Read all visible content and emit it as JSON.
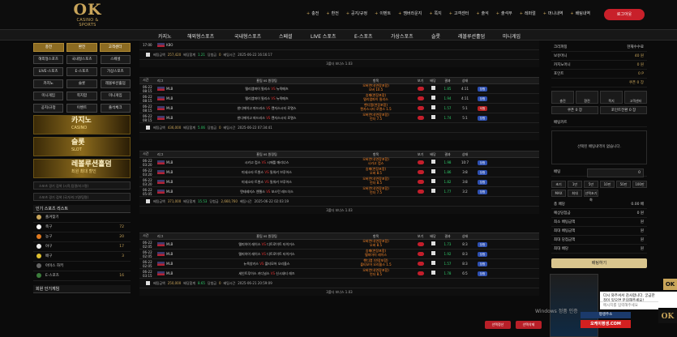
{
  "header": {
    "logo": "OK",
    "logo_sub": "CASINO & SPORTS",
    "top_nav": [
      {
        "icon": "+",
        "label": "충전"
      },
      {
        "icon": "+",
        "label": "환전"
      },
      {
        "icon": "+",
        "label": "공지/규정"
      },
      {
        "icon": "+",
        "label": "이벤트"
      },
      {
        "icon": "+",
        "label": "멤버라운지"
      },
      {
        "icon": "+",
        "label": "쪽지"
      },
      {
        "icon": "+",
        "label": "고객센터"
      },
      {
        "icon": "+",
        "label": "출석"
      },
      {
        "icon": "+",
        "label": "출석부"
      },
      {
        "icon": "+",
        "label": "레퍼럴"
      },
      {
        "icon": "+",
        "label": "머니내역"
      },
      {
        "icon": "+",
        "label": "배팅내역"
      }
    ],
    "logout": "로그아웃"
  },
  "main_nav": [
    "카지노",
    "해외형스포츠",
    "국내형스포츠",
    "스페셜",
    "LIVE 스포츠",
    "E-스포츠",
    "가상스포츠",
    "슬롯",
    "레볼루션홀덤",
    "미니게임"
  ],
  "sidebar": {
    "top_buttons": [
      "충전",
      "환전",
      "고객센터"
    ],
    "categories": [
      "해외형스포츠",
      "국내형스포츠",
      "스페셜",
      "LIVE-스포츠",
      "E-스포츠",
      "가상스포츠",
      "카지노",
      "슬롯",
      "레볼루션홀덤",
      "미니게임",
      "쪽지함",
      "미니게임",
      "공지/규정",
      "이벤트",
      "출석체크"
    ],
    "banners": [
      {
        "title": "카지노",
        "sub": "CASINO"
      },
      {
        "title": "슬롯",
        "sub": "SLOT"
      },
      {
        "title": "레볼루션홀덤",
        "sub": "최원 최대 할인"
      }
    ],
    "search": [
      {
        "placeholder": "스포츠 경기 검색 (시작,팀명/리그명)"
      },
      {
        "placeholder": "스포츠 경기 검색 (국가/리그명/팀명)"
      }
    ],
    "popular_title": "인기 스포츠 리스트",
    "popular": [
      {
        "label": "즐겨찾기",
        "count": "",
        "color": "#c9a55a"
      },
      {
        "label": "축구",
        "count": "72",
        "color": "#ffffff"
      },
      {
        "label": "농구",
        "count": "20",
        "color": "#e07a20"
      },
      {
        "label": "야구",
        "count": "17",
        "color": "#eeeeee"
      },
      {
        "label": "배구",
        "count": "3",
        "color": "#e0c030"
      },
      {
        "label": "아이스 하키",
        "count": "",
        "color": "#666666"
      },
      {
        "label": "E-스포츠",
        "count": "16",
        "color": "#3b7d3b"
      }
    ],
    "bottom_title": "회원 인기게임"
  },
  "table_headers": {
    "time": "시간",
    "league": "리그",
    "match": "홈팀 vs 원정팀",
    "pick": "항목",
    "view": "보기",
    "odds": "배당",
    "result": "결과",
    "status": "상태"
  },
  "panels": [
    {
      "rows": [
        {
          "date": "",
          "time": "17:00",
          "league": "KBO",
          "home": "",
          "away": "",
          "pick": "",
          "pick2": "",
          "odds": "",
          "score": "",
          "status": ""
        }
      ],
      "summary": {
        "label1": "베팅금액",
        "amount": "257,420",
        "label2": "배당합계",
        "total_odds": "1.21",
        "label3": "당첨금",
        "win": "0",
        "label4": "베팅시간",
        "time": "2025-06-22 16:16:17"
      },
      "pager": "3폴더 보너스 1.03"
    },
    {
      "rows": [
        {
          "date": "06-22",
          "time": "08:15",
          "league": "MLB",
          "home": "텔리엠파이 필리스",
          "away": "뉴욕메츠",
          "pick": "오버언더(연장포함)",
          "pick2": "오버 10.5",
          "odds": "1.85",
          "score": "4:11",
          "status": "당첨"
        },
        {
          "date": "06-22",
          "time": "08:15",
          "league": "MLB",
          "home": "텔리엠파이 필리스",
          "away": "뉴욕메츠",
          "pick": "승패(연장포함)",
          "pick2": "텔리엠파이 필리스",
          "odds": "1.94",
          "score": "4:11",
          "status": "당첨"
        },
        {
          "date": "06-22",
          "time": "08:15",
          "league": "MLB",
          "home": "샌디에이고 파드리스",
          "away": "캔자스시티 로열스",
          "pick": "핸디캡(연장포함)",
          "pick2": "캔자스시티 로열스 1.5",
          "odds": "1.57",
          "score": "5:1",
          "status": "낙첨"
        },
        {
          "date": "06-22",
          "time": "08:15",
          "league": "MLB",
          "home": "샌디에이고 파드리스",
          "away": "캔자스시티 로열스",
          "pick": "오버언더(연장포함)",
          "pick2": "언더 7.5",
          "odds": "1.74",
          "score": "5:1",
          "status": "당첨"
        }
      ],
      "summary": {
        "label1": "베팅금액",
        "amount": "436,000",
        "label2": "배당합계",
        "total_odds": "5.06",
        "label3": "당첨금",
        "win": "0",
        "label4": "베팅시간",
        "time": "2025-06-22 07:34:41"
      },
      "pager": ""
    },
    {
      "rows": [
        {
          "date": "06-22",
          "time": "03:20",
          "league": "MLB",
          "home": "시카고 컵스",
          "away": "시애틀 매리너스",
          "pick": "오버언더(연장포함)",
          "pick2": "시카고 컵스",
          "odds": "1.98",
          "score": "10:7",
          "status": "당첨"
        },
        {
          "date": "06-22",
          "time": "03:20",
          "league": "MLB",
          "home": "미네소타 트윈스",
          "away": "밀워키 브루어스",
          "pick": "승패(연장포함)",
          "pick2": "오버 8.5",
          "odds": "1.86",
          "score": "3:8",
          "status": "당첨"
        },
        {
          "date": "06-22",
          "time": "03:20",
          "league": "MLB",
          "home": "미네소타 트윈스",
          "away": "밀워키 브루어스",
          "pick": "오버언더(연장포함)",
          "pick2": "언더 8.5",
          "odds": "1.82",
          "score": "3:8",
          "status": "당첨"
        },
        {
          "date": "06-22",
          "time": "05:05",
          "league": "MLB",
          "home": "텐테레지스 엔젤스",
          "away": "보스턴 레드삭스",
          "pick": "오버언더(연장포함)",
          "pick2": "언더 7.5",
          "odds": "1.77",
          "score": "3:2",
          "status": "당첨"
        }
      ],
      "summary": {
        "label1": "베팅금액",
        "amount": "371,000",
        "label2": "배당합계",
        "total_odds": "15.53",
        "label3": "당첨금",
        "win": "2,660,760",
        "label4": "베팅시간",
        "time": "2025-06-22 02:03:19"
      },
      "pager": "3폴더 보너스 1.03"
    },
    {
      "rows": [
        {
          "date": "06-22",
          "time": "02:05",
          "league": "MLB",
          "home": "텔피아이 레이스",
          "away": "디트로이트 타이거스",
          "pick": "오버언더(연장포함)",
          "pick2": "오버 8.5",
          "odds": "1.73",
          "score": "8:3",
          "status": "당첨"
        },
        {
          "date": "06-22",
          "time": "02:05",
          "league": "MLB",
          "home": "텔피아이 레이스",
          "away": "디트로이트 타이거스",
          "pick": "승패(연장포함)",
          "pick2": "텔피아이 레이스",
          "odds": "1.92",
          "score": "8:3",
          "status": "당첨"
        },
        {
          "date": "06-22",
          "time": "02:05",
          "league": "MLB",
          "home": "뉴욕양키스",
          "away": "볼티모어 오리올스",
          "pick": "핸디캡 (연장포함)",
          "pick2": "볼티모어 오리올스 1.5",
          "odds": "1.57",
          "score": "8:3",
          "status": "당첨"
        },
        {
          "date": "06-22",
          "time": "03:15",
          "league": "MLB",
          "home": "세인트루이스 카디널스",
          "away": "신시내티 레즈",
          "pick": "오버언더(연장포함)",
          "pick2": "언더 8.5",
          "odds": "1.78",
          "score": "6:5",
          "status": "당첨"
        }
      ],
      "summary": {
        "label1": "베팅금액",
        "amount": "250,000",
        "label2": "배당합계",
        "total_odds": "8.65",
        "label3": "당첨금",
        "win": "0",
        "label4": "베팅시간",
        "time": "2025-06-21 20:59:09"
      },
      "pager": "3폴더 보너스 1.03"
    }
  ],
  "right": {
    "username": "크리파칭",
    "level": "현재수수료",
    "money_rows": [
      {
        "label": "보유머니",
        "value": "40 원"
      },
      {
        "label": "카지노머니",
        "value": "0 원"
      },
      {
        "label": "포인트",
        "value": "0 P"
      },
      {
        "label": "",
        "value": "쿠폰 0 장"
      }
    ],
    "icon_buttons": [
      "충전",
      "환전",
      "쪽지",
      "고객센터"
    ],
    "sub_buttons": [
      "쿠폰 0 장",
      "포인트전환 0 장"
    ],
    "cart_title": "배팅카트",
    "cart_empty": "선택된 배팅내역이 없습니다.",
    "bet_label": "배팅",
    "bet_value": "0",
    "quick": [
      "초기",
      "1만",
      "5만",
      "10만",
      "50만",
      "100만",
      "MAX",
      "최대",
      "선택초기화"
    ],
    "summary_rows": [
      {
        "label": "총 배당",
        "value": "0.00 배"
      },
      {
        "label": "예상당첨금",
        "value": "0 원"
      },
      {
        "label": "최소 배팅금액",
        "value": "원"
      },
      {
        "label": "최대 배팅금액",
        "value": "원"
      },
      {
        "label": "최대 당첨금액",
        "value": "원"
      },
      {
        "label": "최대 배당",
        "value": "원"
      }
    ],
    "submit": "배팅하기"
  },
  "float_buttons": [
    "선택정산",
    "선택삭제"
  ],
  "chat_popup": {
    "line1": "다시 와주셔서 감사합니다. 궁금한",
    "line2": "점이 있으면 문의해주세요!",
    "input": "메시지를 입력해주세요"
  },
  "watermark": "Windows 정품 인증",
  "promo": {
    "title": "평생주소",
    "url": "오케이평생.COM"
  },
  "corner_logo": "OK"
}
